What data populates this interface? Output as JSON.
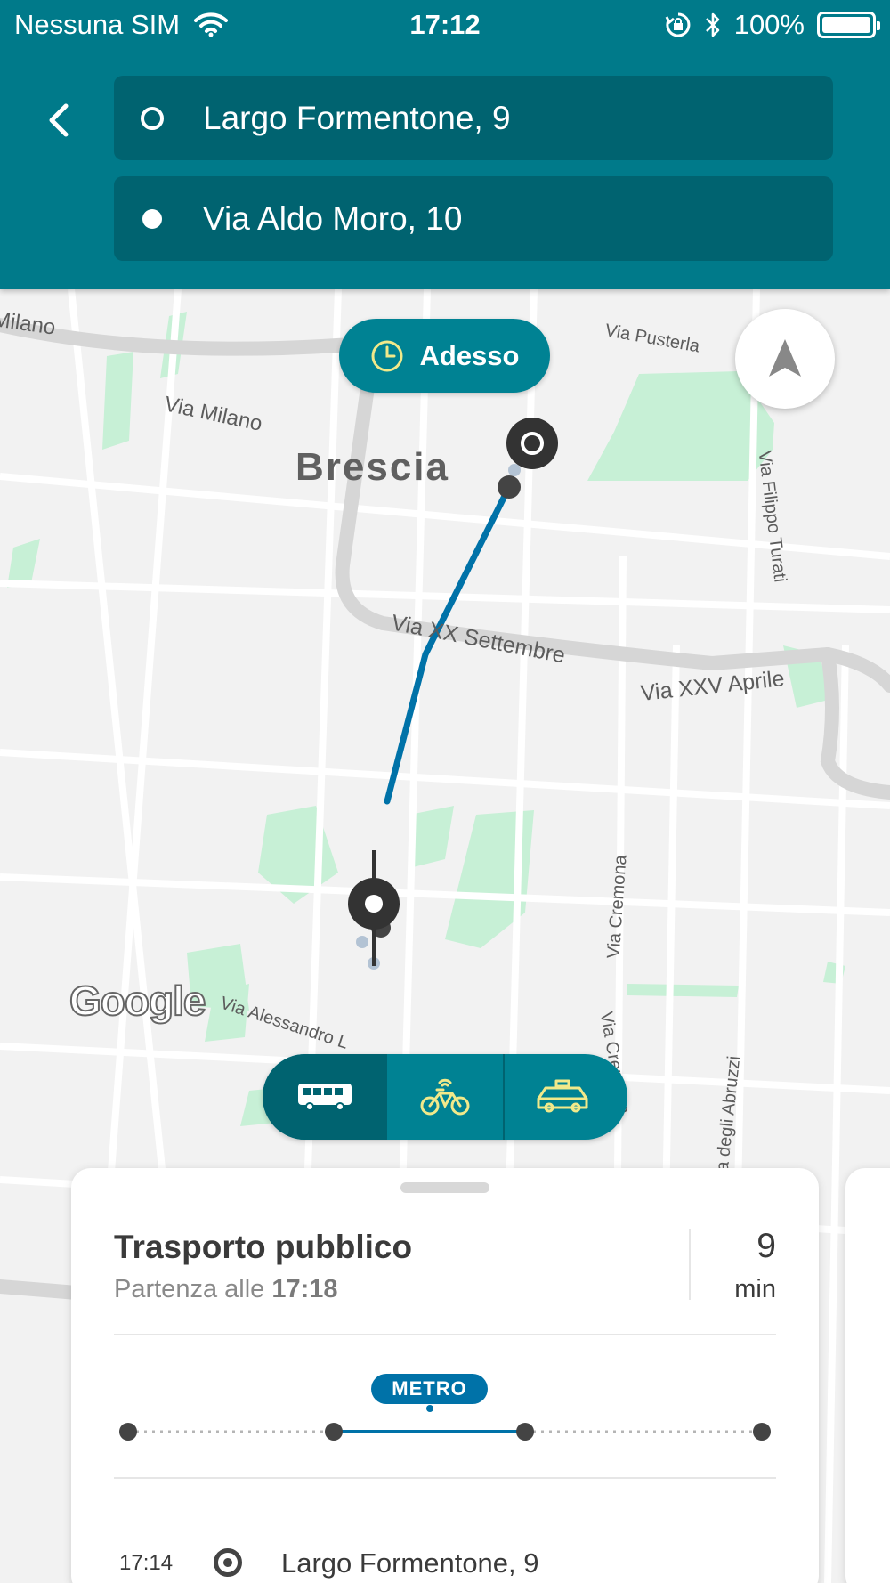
{
  "status_bar": {
    "carrier": "Nessuna SIM",
    "time": "17:12",
    "battery": "100%"
  },
  "route": {
    "from": "Largo Formentone, 9",
    "to": "Via Aldo Moro, 10"
  },
  "map": {
    "city": "Brescia",
    "time_button": "Adesso",
    "attribution": "Google",
    "streets": {
      "milano_left": "Milano",
      "via_milano": "Via Milano",
      "via_pusterla": "Via Pusterla",
      "via_filippo_turati": "Via Filippo Turati",
      "via_xx_settembre": "Via XX Settembre",
      "via_xxv_aprile": "Via XXV Aprile",
      "via_cremona_1": "Via Cremona",
      "via_cremona_2": "Via Cremona",
      "via_alessandro": "Via Alessandro L",
      "via_abruzzi": "uca degli Abruzzi"
    },
    "colors": {
      "route": "#0072a8",
      "park": "#c7f0d6",
      "road": "#ffffff",
      "major_road": "#d6d6d6"
    }
  },
  "transport_modes": [
    {
      "name": "bus",
      "icon": "bus-icon",
      "active": true
    },
    {
      "name": "bike",
      "icon": "bike-sharing-icon",
      "active": false
    },
    {
      "name": "taxi",
      "icon": "taxi-icon",
      "active": false
    }
  ],
  "option_card": {
    "title": "Trasporto pubblico",
    "departure_prefix": "Partenza alle",
    "departure_time": "17:18",
    "duration_value": "9",
    "duration_unit": "min",
    "leg_badge": "METRO",
    "first_step": {
      "time": "17:14",
      "name": "Largo Formentone, 9"
    }
  },
  "colors": {
    "header": "#007a8a",
    "header_field": "#006370",
    "accent_yellow": "#f1e98a",
    "metro_blue": "#0072a8"
  }
}
